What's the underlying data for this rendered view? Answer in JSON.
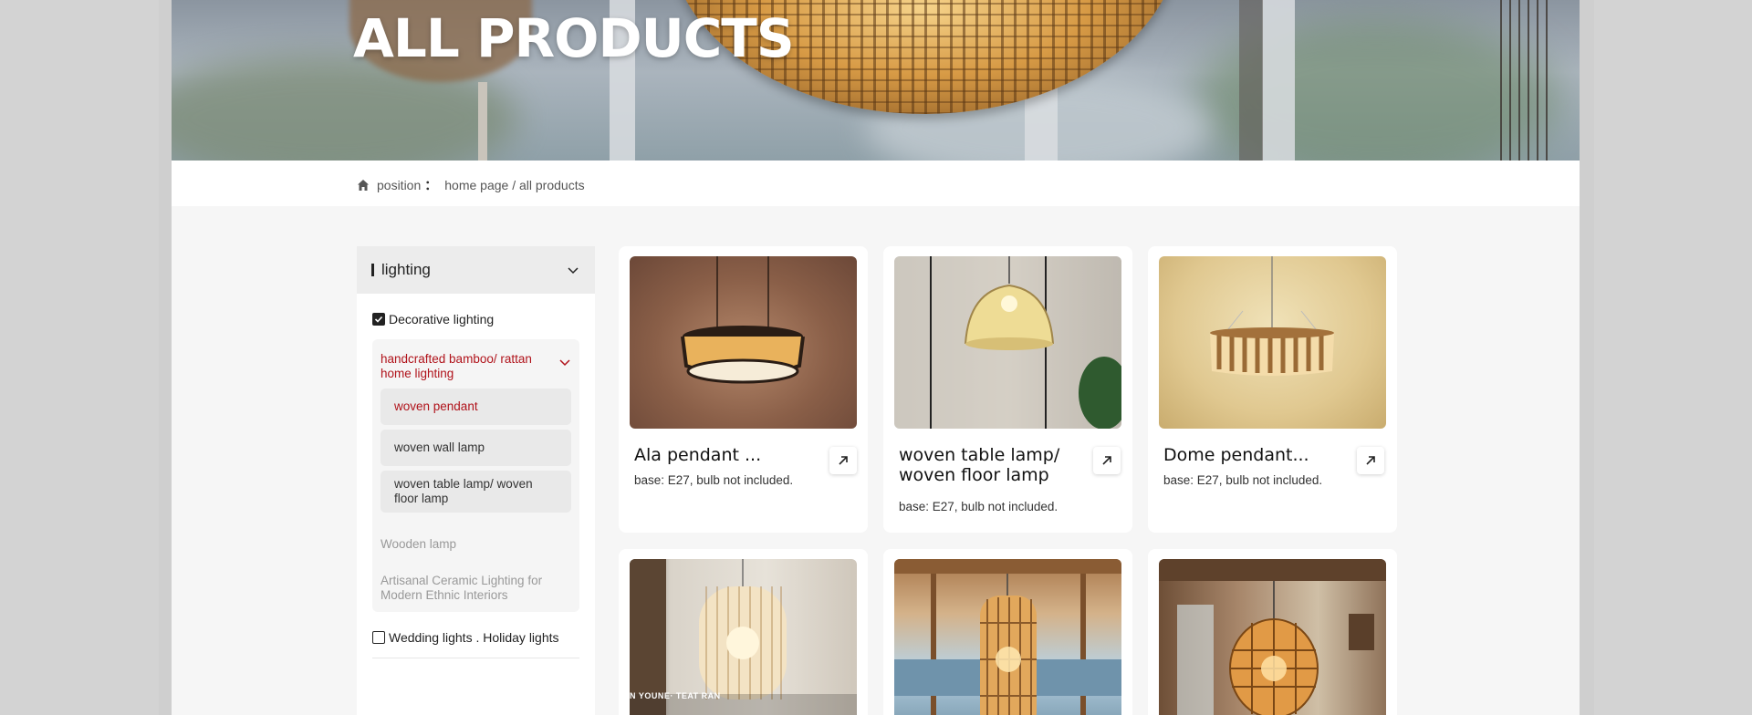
{
  "hero": {
    "title": "ALL PRODUCTS"
  },
  "breadcrumb": {
    "label": "position",
    "separator": "：",
    "path": "home page / all products"
  },
  "sidebar": {
    "category": "lighting",
    "groups": [
      {
        "label": "Decorative lighting",
        "checked": true
      },
      {
        "label": "Wedding lights . Holiday lights",
        "checked": false
      }
    ],
    "subcategory": "handcrafted bamboo/ rattan home lighting",
    "items": [
      {
        "label": "woven pendant",
        "active": true
      },
      {
        "label": "woven wall lamp",
        "active": false
      },
      {
        "label": "woven table lamp/ woven floor lamp",
        "active": false
      }
    ],
    "other_items": [
      "Wooden lamp",
      "Artisanal Ceramic Lighting for Modern Ethnic Interiors"
    ]
  },
  "products": [
    {
      "title": "Ala pendant ...",
      "desc": "base: E27, bulb not included."
    },
    {
      "title": "woven table lamp/ woven  floor lamp",
      "desc": "base: E27, bulb not included."
    },
    {
      "title": "Dome pendant...",
      "desc": "base: E27, bulb not included."
    }
  ],
  "second_row": {
    "image_caption": "N YOUNE· TEAT RAN"
  },
  "colors": {
    "accent_red": "#b0121a",
    "panel_gray": "#ececec",
    "page_bg": "#f6f6f6"
  }
}
